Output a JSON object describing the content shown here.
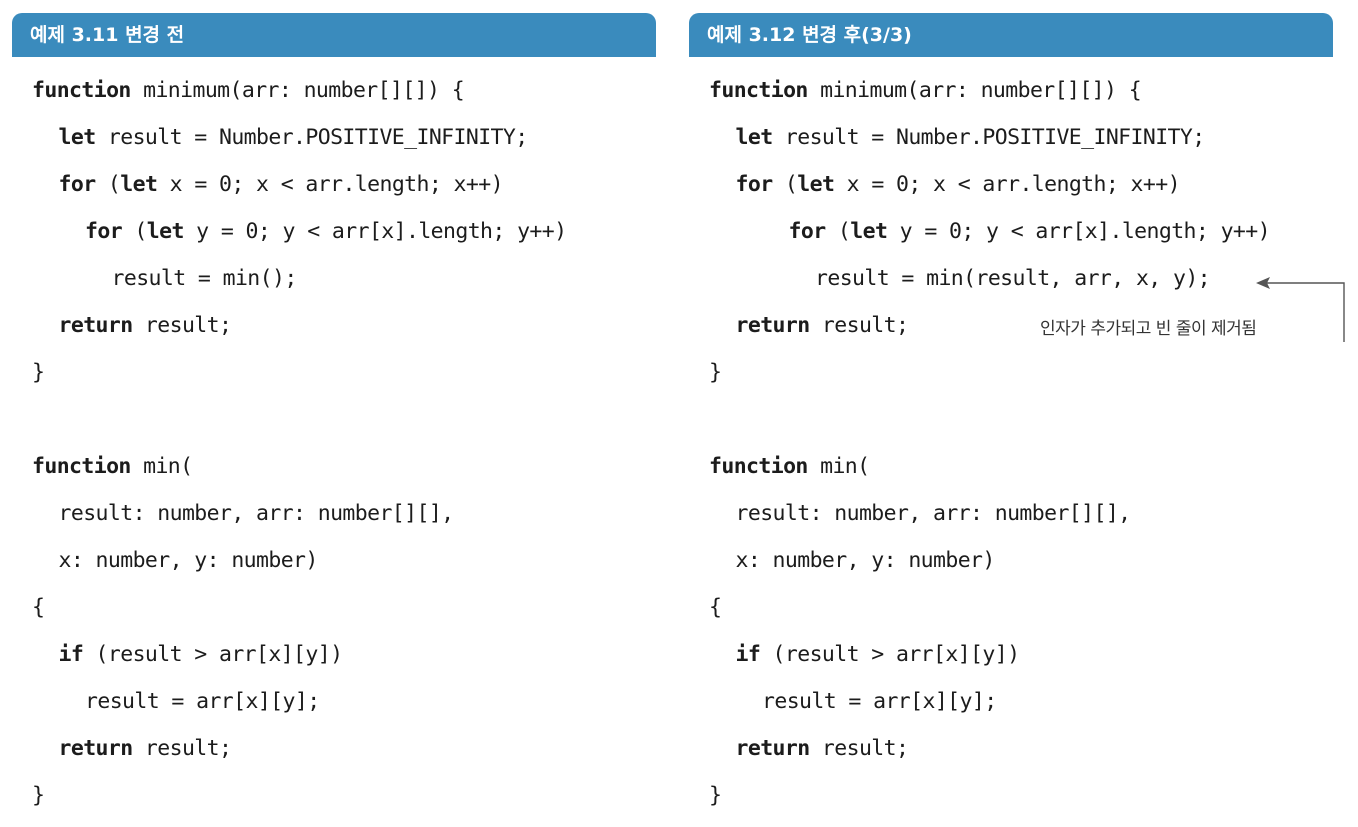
{
  "left_panel": {
    "title": "예제 3.11 변경 전",
    "lines": [
      {
        "indent": 0,
        "parts": [
          {
            "t": "function",
            "kw": true
          },
          {
            "t": " minimum(arr: number[][]) {"
          }
        ]
      },
      {
        "indent": 1,
        "parts": [
          {
            "t": "let",
            "kw": true
          },
          {
            "t": " result = Number.POSITIVE_INFINITY;"
          }
        ]
      },
      {
        "indent": 1,
        "parts": [
          {
            "t": "for",
            "kw": true
          },
          {
            "t": " ("
          },
          {
            "t": "let",
            "kw": true
          },
          {
            "t": " x = 0; x < arr.length; x++)"
          }
        ]
      },
      {
        "indent": 2,
        "parts": [
          {
            "t": "for",
            "kw": true
          },
          {
            "t": " ("
          },
          {
            "t": "let",
            "kw": true
          },
          {
            "t": " y = 0; y < arr[x].length; y++)"
          }
        ]
      },
      {
        "indent": 3,
        "parts": [
          {
            "t": "result = min();"
          }
        ]
      },
      {
        "indent": 1,
        "parts": [
          {
            "t": "return",
            "kw": true
          },
          {
            "t": " result;"
          }
        ]
      },
      {
        "indent": 0,
        "parts": [
          {
            "t": "}"
          }
        ]
      },
      {
        "indent": 0,
        "parts": []
      },
      {
        "indent": 0,
        "parts": [
          {
            "t": "function",
            "kw": true
          },
          {
            "t": " min("
          }
        ]
      },
      {
        "indent": 1,
        "parts": [
          {
            "t": "result: number, arr: number[][],"
          }
        ]
      },
      {
        "indent": 1,
        "parts": [
          {
            "t": "x: number, y: number)"
          }
        ]
      },
      {
        "indent": 0,
        "parts": [
          {
            "t": "{"
          }
        ]
      },
      {
        "indent": 1,
        "parts": [
          {
            "t": "if",
            "kw": true
          },
          {
            "t": " (result > arr[x][y])"
          }
        ]
      },
      {
        "indent": 2,
        "parts": [
          {
            "t": "result = arr[x][y];"
          }
        ]
      },
      {
        "indent": 1,
        "parts": [
          {
            "t": "return",
            "kw": true
          },
          {
            "t": " result;"
          }
        ]
      },
      {
        "indent": 0,
        "parts": [
          {
            "t": "}"
          }
        ]
      }
    ]
  },
  "right_panel": {
    "title": "예제 3.12 변경 후(3/3)",
    "lines": [
      {
        "indent": 0,
        "parts": [
          {
            "t": "function",
            "kw": true
          },
          {
            "t": " minimum(arr: number[][]) {"
          }
        ]
      },
      {
        "indent": 1,
        "parts": [
          {
            "t": "let",
            "kw": true
          },
          {
            "t": " result = Number.POSITIVE_INFINITY;"
          }
        ]
      },
      {
        "indent": 1,
        "parts": [
          {
            "t": "for",
            "kw": true
          },
          {
            "t": " ("
          },
          {
            "t": "let",
            "kw": true
          },
          {
            "t": " x = 0; x < arr.length; x++)"
          }
        ]
      },
      {
        "indent": 3,
        "parts": [
          {
            "t": "for",
            "kw": true
          },
          {
            "t": " ("
          },
          {
            "t": "let",
            "kw": true
          },
          {
            "t": " y = 0; y < arr[x].length; y++)"
          }
        ]
      },
      {
        "indent": 4,
        "parts": [
          {
            "t": "result = min(result, arr, x, y);"
          }
        ]
      },
      {
        "indent": 1,
        "parts": [
          {
            "t": "return",
            "kw": true
          },
          {
            "t": " result;"
          }
        ]
      },
      {
        "indent": 0,
        "parts": [
          {
            "t": "}"
          }
        ]
      },
      {
        "indent": 0,
        "parts": []
      },
      {
        "indent": 0,
        "parts": [
          {
            "t": "function",
            "kw": true
          },
          {
            "t": " min("
          }
        ]
      },
      {
        "indent": 1,
        "parts": [
          {
            "t": "result: number, arr: number[][],"
          }
        ]
      },
      {
        "indent": 1,
        "parts": [
          {
            "t": "x: number, y: number)"
          }
        ]
      },
      {
        "indent": 0,
        "parts": [
          {
            "t": "{"
          }
        ]
      },
      {
        "indent": 1,
        "parts": [
          {
            "t": "if",
            "kw": true
          },
          {
            "t": " (result > arr[x][y])"
          }
        ]
      },
      {
        "indent": 2,
        "parts": [
          {
            "t": "result = arr[x][y];"
          }
        ]
      },
      {
        "indent": 1,
        "parts": [
          {
            "t": "return",
            "kw": true
          },
          {
            "t": " result;"
          }
        ]
      },
      {
        "indent": 0,
        "parts": [
          {
            "t": "}"
          }
        ]
      }
    ],
    "annotation": "인자가 추가되고 빈 줄이 제거됨"
  },
  "colors": {
    "header_bg": "#3a8bbd",
    "header_text": "#ffffff",
    "code_text": "#1c1c1c",
    "annotation_line": "#555555"
  }
}
